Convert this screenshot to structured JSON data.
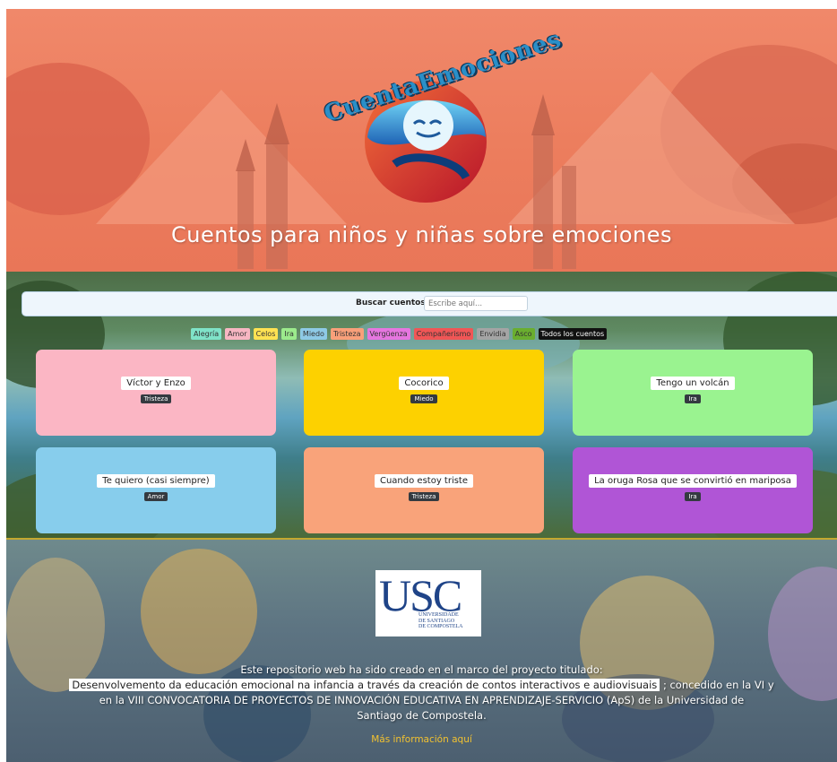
{
  "header": {
    "logo_text": "CuentaEmociones",
    "title": "Cuentos para niños y niñas sobre emociones"
  },
  "search": {
    "label": "Buscar cuentos:",
    "placeholder": "Escribe aquí..."
  },
  "filters": [
    {
      "label": "Alegría",
      "color": "#7fe3c8"
    },
    {
      "label": "Amor",
      "color": "#f7b6c2"
    },
    {
      "label": "Celos",
      "color": "#ffe252"
    },
    {
      "label": "Ira",
      "color": "#9ceb8c"
    },
    {
      "label": "Miedo",
      "color": "#8ecae6"
    },
    {
      "label": "Tristeza",
      "color": "#f9a07a"
    },
    {
      "label": "Vergüenza",
      "color": "#e676e0"
    },
    {
      "label": "Compañerismo",
      "color": "#f05656"
    },
    {
      "label": "Envidia",
      "color": "#a4a4a4"
    },
    {
      "label": "Asco",
      "color": "#6aae2f"
    },
    {
      "label": "Todos los cuentos",
      "color": "#111111"
    }
  ],
  "stories": [
    {
      "title": "Víctor y Enzo",
      "tag": "Tristeza",
      "color": "#fbb6c4"
    },
    {
      "title": "Cocorico",
      "tag": "Miedo",
      "color": "#fdd100"
    },
    {
      "title": "Tengo un volcán",
      "tag": "Ira",
      "color": "#9af390"
    },
    {
      "title": "Te quiero (casi siempre)",
      "tag": "Amor",
      "color": "#87cdec"
    },
    {
      "title": "Cuando estoy triste",
      "tag": "Tristeza",
      "color": "#f9a37a"
    },
    {
      "title": "La oruga Rosa que se convirtió en mariposa",
      "tag": "Ira",
      "color": "#b055d6"
    }
  ],
  "footer": {
    "usc_letters": "USC",
    "usc_subtitle": "UNIVERSIDADE\nDE SANTIAGO\nDE COMPOSTELA",
    "line1": "Este repositorio web ha sido creado en el marco del proyecto titulado:",
    "project_title": "Desenvolvemento da educación emocional na infancia a través da creación de contos interactivos e audiovisuais",
    "line2_suffix": "; concedido en la VI y",
    "line3": "en la VIII CONVOCATORIA DE PROYECTOS DE INNOVACIÓN EDUCATIVA EN APRENDIZAJE-SERVICIO (ApS) de la Universidad de",
    "line4": "Santiago de Compostela.",
    "more_link": "Más información aquí"
  }
}
